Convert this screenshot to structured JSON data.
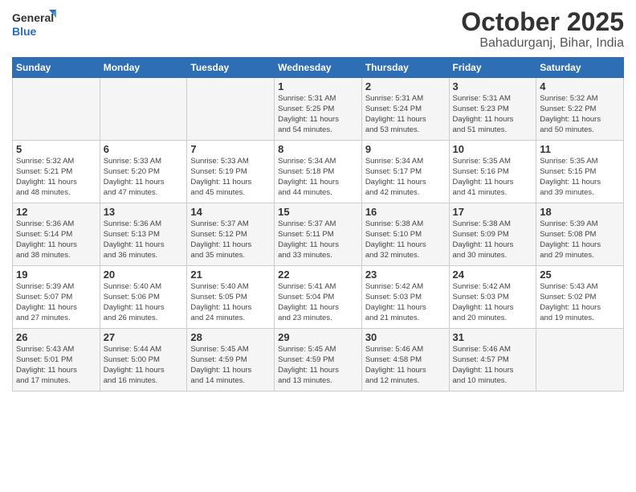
{
  "logo": {
    "line1": "General",
    "line2": "Blue"
  },
  "title": "October 2025",
  "subtitle": "Bahadurganj, Bihar, India",
  "weekdays": [
    "Sunday",
    "Monday",
    "Tuesday",
    "Wednesday",
    "Thursday",
    "Friday",
    "Saturday"
  ],
  "weeks": [
    [
      {
        "day": "",
        "info": ""
      },
      {
        "day": "",
        "info": ""
      },
      {
        "day": "",
        "info": ""
      },
      {
        "day": "1",
        "info": "Sunrise: 5:31 AM\nSunset: 5:25 PM\nDaylight: 11 hours\nand 54 minutes."
      },
      {
        "day": "2",
        "info": "Sunrise: 5:31 AM\nSunset: 5:24 PM\nDaylight: 11 hours\nand 53 minutes."
      },
      {
        "day": "3",
        "info": "Sunrise: 5:31 AM\nSunset: 5:23 PM\nDaylight: 11 hours\nand 51 minutes."
      },
      {
        "day": "4",
        "info": "Sunrise: 5:32 AM\nSunset: 5:22 PM\nDaylight: 11 hours\nand 50 minutes."
      }
    ],
    [
      {
        "day": "5",
        "info": "Sunrise: 5:32 AM\nSunset: 5:21 PM\nDaylight: 11 hours\nand 48 minutes."
      },
      {
        "day": "6",
        "info": "Sunrise: 5:33 AM\nSunset: 5:20 PM\nDaylight: 11 hours\nand 47 minutes."
      },
      {
        "day": "7",
        "info": "Sunrise: 5:33 AM\nSunset: 5:19 PM\nDaylight: 11 hours\nand 45 minutes."
      },
      {
        "day": "8",
        "info": "Sunrise: 5:34 AM\nSunset: 5:18 PM\nDaylight: 11 hours\nand 44 minutes."
      },
      {
        "day": "9",
        "info": "Sunrise: 5:34 AM\nSunset: 5:17 PM\nDaylight: 11 hours\nand 42 minutes."
      },
      {
        "day": "10",
        "info": "Sunrise: 5:35 AM\nSunset: 5:16 PM\nDaylight: 11 hours\nand 41 minutes."
      },
      {
        "day": "11",
        "info": "Sunrise: 5:35 AM\nSunset: 5:15 PM\nDaylight: 11 hours\nand 39 minutes."
      }
    ],
    [
      {
        "day": "12",
        "info": "Sunrise: 5:36 AM\nSunset: 5:14 PM\nDaylight: 11 hours\nand 38 minutes."
      },
      {
        "day": "13",
        "info": "Sunrise: 5:36 AM\nSunset: 5:13 PM\nDaylight: 11 hours\nand 36 minutes."
      },
      {
        "day": "14",
        "info": "Sunrise: 5:37 AM\nSunset: 5:12 PM\nDaylight: 11 hours\nand 35 minutes."
      },
      {
        "day": "15",
        "info": "Sunrise: 5:37 AM\nSunset: 5:11 PM\nDaylight: 11 hours\nand 33 minutes."
      },
      {
        "day": "16",
        "info": "Sunrise: 5:38 AM\nSunset: 5:10 PM\nDaylight: 11 hours\nand 32 minutes."
      },
      {
        "day": "17",
        "info": "Sunrise: 5:38 AM\nSunset: 5:09 PM\nDaylight: 11 hours\nand 30 minutes."
      },
      {
        "day": "18",
        "info": "Sunrise: 5:39 AM\nSunset: 5:08 PM\nDaylight: 11 hours\nand 29 minutes."
      }
    ],
    [
      {
        "day": "19",
        "info": "Sunrise: 5:39 AM\nSunset: 5:07 PM\nDaylight: 11 hours\nand 27 minutes."
      },
      {
        "day": "20",
        "info": "Sunrise: 5:40 AM\nSunset: 5:06 PM\nDaylight: 11 hours\nand 26 minutes."
      },
      {
        "day": "21",
        "info": "Sunrise: 5:40 AM\nSunset: 5:05 PM\nDaylight: 11 hours\nand 24 minutes."
      },
      {
        "day": "22",
        "info": "Sunrise: 5:41 AM\nSunset: 5:04 PM\nDaylight: 11 hours\nand 23 minutes."
      },
      {
        "day": "23",
        "info": "Sunrise: 5:42 AM\nSunset: 5:03 PM\nDaylight: 11 hours\nand 21 minutes."
      },
      {
        "day": "24",
        "info": "Sunrise: 5:42 AM\nSunset: 5:03 PM\nDaylight: 11 hours\nand 20 minutes."
      },
      {
        "day": "25",
        "info": "Sunrise: 5:43 AM\nSunset: 5:02 PM\nDaylight: 11 hours\nand 19 minutes."
      }
    ],
    [
      {
        "day": "26",
        "info": "Sunrise: 5:43 AM\nSunset: 5:01 PM\nDaylight: 11 hours\nand 17 minutes."
      },
      {
        "day": "27",
        "info": "Sunrise: 5:44 AM\nSunset: 5:00 PM\nDaylight: 11 hours\nand 16 minutes."
      },
      {
        "day": "28",
        "info": "Sunrise: 5:45 AM\nSunset: 4:59 PM\nDaylight: 11 hours\nand 14 minutes."
      },
      {
        "day": "29",
        "info": "Sunrise: 5:45 AM\nSunset: 4:59 PM\nDaylight: 11 hours\nand 13 minutes."
      },
      {
        "day": "30",
        "info": "Sunrise: 5:46 AM\nSunset: 4:58 PM\nDaylight: 11 hours\nand 12 minutes."
      },
      {
        "day": "31",
        "info": "Sunrise: 5:46 AM\nSunset: 4:57 PM\nDaylight: 11 hours\nand 10 minutes."
      },
      {
        "day": "",
        "info": ""
      }
    ]
  ]
}
